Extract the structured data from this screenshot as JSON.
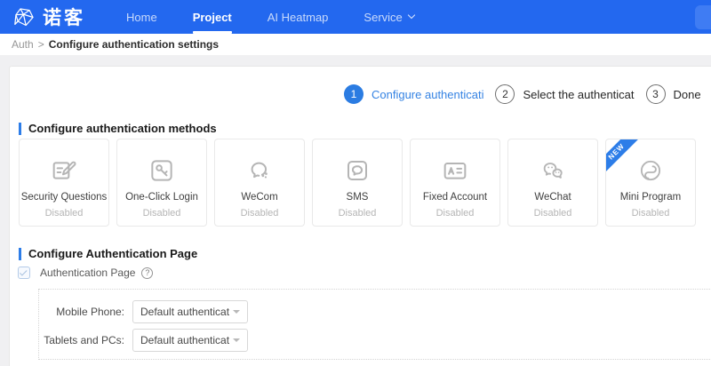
{
  "colors": {
    "nav_blue": "#2368ef",
    "accent_blue": "#2d7de8",
    "step_blue": "#2b7ce2"
  },
  "nav": {
    "logo_text": "诺客",
    "items": [
      {
        "label": "Home"
      },
      {
        "label": "Project"
      },
      {
        "label": "AI Heatmap"
      },
      {
        "label": "Service"
      }
    ]
  },
  "breadcrumb": {
    "parent": "Auth",
    "separator": ">",
    "current": "Configure authentication settings"
  },
  "steps": [
    {
      "number": "1",
      "label": "Configure authenticati"
    },
    {
      "number": "2",
      "label": "Select the authenticat"
    },
    {
      "number": "3",
      "label": "Done"
    }
  ],
  "methods": {
    "title": "Configure authentication methods",
    "cards": [
      {
        "title": "Security Questions",
        "status": "Disabled",
        "icon": "security-questions-icon"
      },
      {
        "title": "One-Click Login",
        "status": "Disabled",
        "icon": "one-click-login-icon"
      },
      {
        "title": "WeCom",
        "status": "Disabled",
        "icon": "wecom-icon"
      },
      {
        "title": "SMS",
        "status": "Disabled",
        "icon": "sms-icon"
      },
      {
        "title": "Fixed Account",
        "status": "Disabled",
        "icon": "fixed-account-icon"
      },
      {
        "title": "WeChat",
        "status": "Disabled",
        "icon": "wechat-icon"
      },
      {
        "title": "Mini Program",
        "status": "Disabled",
        "icon": "mini-program-icon",
        "badge": "NEW"
      }
    ]
  },
  "page_config": {
    "title": "Configure Authentication Page",
    "checkbox_label": "Authentication Page",
    "checkbox_checked": true,
    "help_glyph": "?",
    "fields": [
      {
        "label": "Mobile Phone:",
        "value": "Default authenticatio..."
      },
      {
        "label": "Tablets and PCs:",
        "value": "Default authenticatio..."
      }
    ]
  }
}
